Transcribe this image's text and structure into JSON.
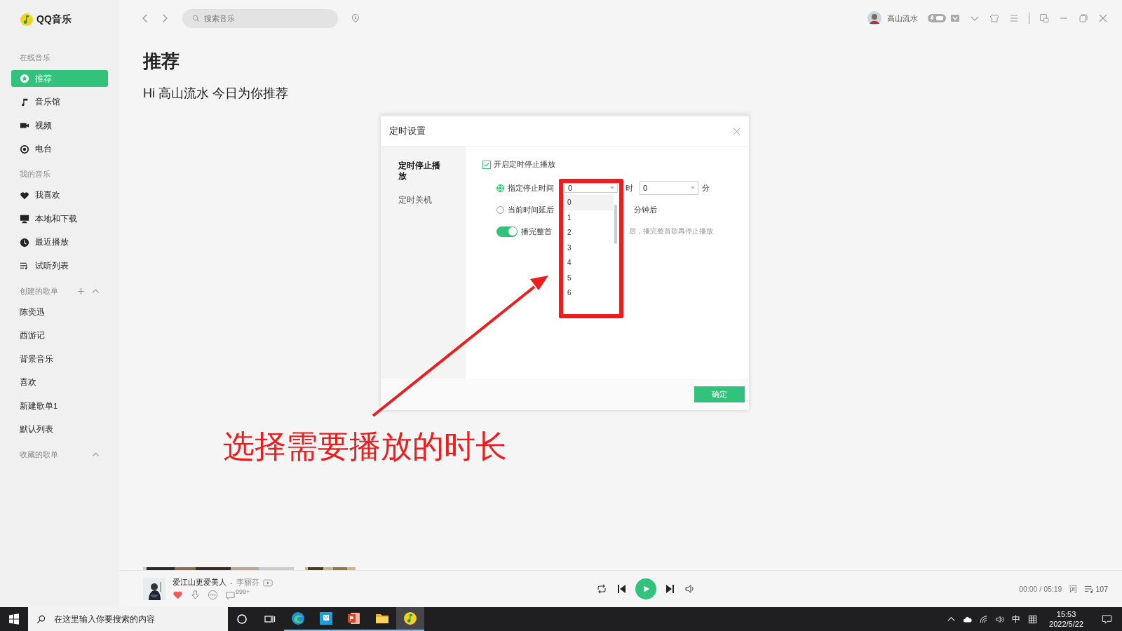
{
  "app": {
    "logo": "QQ音乐"
  },
  "topbar": {
    "search_placeholder": "搜索音乐",
    "user_name": "高山流水"
  },
  "sidebar": {
    "sections": [
      {
        "title": "在线音乐",
        "items": [
          {
            "label": "推荐",
            "selected": true
          },
          {
            "label": "音乐馆",
            "selected": false
          },
          {
            "label": "视频",
            "selected": false
          },
          {
            "label": "电台",
            "selected": false
          }
        ]
      },
      {
        "title": "我的音乐",
        "items": [
          {
            "label": "我喜欢",
            "selected": false
          },
          {
            "label": "本地和下载",
            "selected": false
          },
          {
            "label": "最近播放",
            "selected": false
          },
          {
            "label": "试听列表",
            "selected": false
          }
        ]
      },
      {
        "title": "创建的歌单",
        "expanded": true,
        "items": [
          {
            "label": "陈奕迅",
            "selected": false
          },
          {
            "label": "西游记",
            "selected": false
          },
          {
            "label": "背景音乐",
            "selected": false
          },
          {
            "label": "喜欢",
            "selected": false
          },
          {
            "label": "新建歌单1",
            "selected": false
          },
          {
            "label": "默认列表",
            "selected": false
          }
        ]
      },
      {
        "title": "收藏的歌单",
        "expanded": true
      }
    ]
  },
  "page": {
    "title": "推荐",
    "greeting": "Hi 高山流水 今日为你推荐"
  },
  "dialog": {
    "title": "定时设置",
    "tabs": [
      {
        "label": "定时停止播放",
        "selected": true
      },
      {
        "label": "定时关机",
        "selected": false
      }
    ],
    "enable": {
      "label": "开启定时停止播放",
      "checked": true
    },
    "at_time": {
      "label": "指定停止时间",
      "selected": true,
      "hour": "0",
      "hour_unit": "时",
      "minute": "0",
      "minute_unit": "分"
    },
    "delay": {
      "label": "当前时间延后",
      "selected": false,
      "unit": "分钟后"
    },
    "finish_song": {
      "label": "播完整首",
      "on": true,
      "hint": "后，播完整首歌再停止播放"
    },
    "hour_options": [
      {
        "label": "0",
        "selected": true
      },
      {
        "label": "1",
        "selected": false
      },
      {
        "label": "2",
        "selected": false
      },
      {
        "label": "3",
        "selected": false
      },
      {
        "label": "4",
        "selected": false
      },
      {
        "label": "5",
        "selected": false
      },
      {
        "label": "6",
        "selected": false
      }
    ],
    "confirm": "确定"
  },
  "annotation": {
    "text": "选择需要播放的时长"
  },
  "player": {
    "song": "爱江山更爱美人",
    "separator": "-",
    "artist": "李丽芬",
    "liked": true,
    "comments": "999+",
    "time": "00:00 / 05:19",
    "lyrics": "词",
    "queue_count": "107"
  },
  "taskbar": {
    "search_placeholder": "在这里输入你要搜索的内容",
    "ime": "中",
    "time": "15:53",
    "date": "2022/5/22",
    "apps": [
      {
        "running": true,
        "active": false
      },
      {
        "running": true,
        "active": false
      },
      {
        "running": true,
        "active": false
      },
      {
        "running": true,
        "active": false
      },
      {
        "running": true,
        "active": true
      }
    ]
  }
}
